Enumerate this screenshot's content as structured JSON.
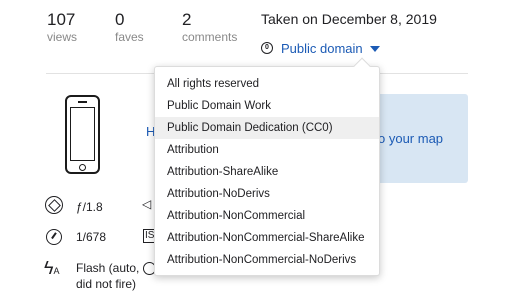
{
  "stats": [
    {
      "value": "107",
      "label": "views"
    },
    {
      "value": "0",
      "label": "faves"
    },
    {
      "value": "2",
      "label": "comments"
    }
  ],
  "taken": "Taken on December 8, 2019",
  "license": {
    "icon": "cc0-icon",
    "current": "Public domain",
    "link_color": "#1c5bb5",
    "options": [
      "All rights reserved",
      "Public Domain Work",
      "Public Domain Dedication (CC0)",
      "Attribution",
      "Attribution-ShareAlike",
      "Attribution-NoDerivs",
      "Attribution-NonCommercial",
      "Attribution-NonCommercial-ShareAlike",
      "Attribution-NonCommercial-NoDerivs"
    ],
    "highlighted": "Public Domain Dedication (CC0)"
  },
  "camera": {
    "partial_link": "H"
  },
  "map": {
    "link_partial": "o your map",
    "background": "#d8e6f3"
  },
  "exif": {
    "aperture": "ƒ/1.8",
    "exposure": "1/678",
    "flash": "Flash (auto, did not fire)"
  }
}
